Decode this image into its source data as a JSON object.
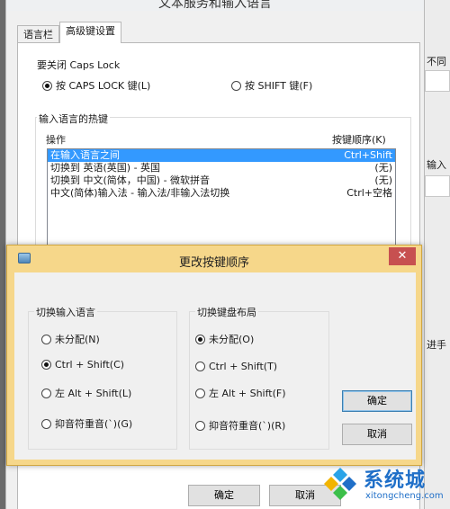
{
  "outer_window": {
    "title": "文本服务和输入语言",
    "tabs": [
      {
        "label": "语言栏"
      },
      {
        "label": "高级键设置"
      }
    ],
    "caps_lock": {
      "label": "要关闭 Caps Lock",
      "options": [
        {
          "label": "按 CAPS LOCK 键(L)",
          "selected": true
        },
        {
          "label": "按 SHIFT 键(F)",
          "selected": false
        }
      ]
    },
    "hotkeys": {
      "label": "输入语言的热键",
      "col_action": "操作",
      "col_sequence": "按键顺序(K)",
      "rows": [
        {
          "action": "在输入语言之间",
          "keys": "Ctrl+Shift",
          "selected": true
        },
        {
          "action": "切换到 英语(英国) - 英国",
          "keys": "(无)",
          "selected": false
        },
        {
          "action": "切换到 中文(简体，中国) - 微软拼音",
          "keys": "(无)",
          "selected": false
        },
        {
          "action": "中文(简体)输入法 - 输入法/非输入法切换",
          "keys": "Ctrl+空格",
          "selected": false
        }
      ]
    },
    "ok_label": "确定",
    "cancel_label": "取消"
  },
  "right_window": {
    "snippets": [
      "不同",
      "输入",
      "进手"
    ]
  },
  "dialog": {
    "title": "更改按键顺序",
    "close_glyph": "✕",
    "switch_language": {
      "label": "切换输入语言",
      "options": [
        {
          "label": "未分配(N)",
          "selected": false
        },
        {
          "label": "Ctrl + Shift(C)",
          "selected": true
        },
        {
          "label": "左 Alt + Shift(L)",
          "selected": false
        },
        {
          "label": "抑音符重音(`)(G)",
          "selected": false
        }
      ]
    },
    "switch_layout": {
      "label": "切换键盘布局",
      "options": [
        {
          "label": "未分配(O)",
          "selected": true
        },
        {
          "label": "Ctrl + Shift(T)",
          "selected": false
        },
        {
          "label": "左 Alt + Shift(F)",
          "selected": false
        },
        {
          "label": "抑音符重音(`)(R)",
          "selected": false
        }
      ]
    },
    "ok_label": "确定",
    "cancel_label": "取消"
  },
  "watermark": {
    "name": "系统城",
    "url": "xitongcheng.com",
    "color": "#1f6fc8"
  }
}
